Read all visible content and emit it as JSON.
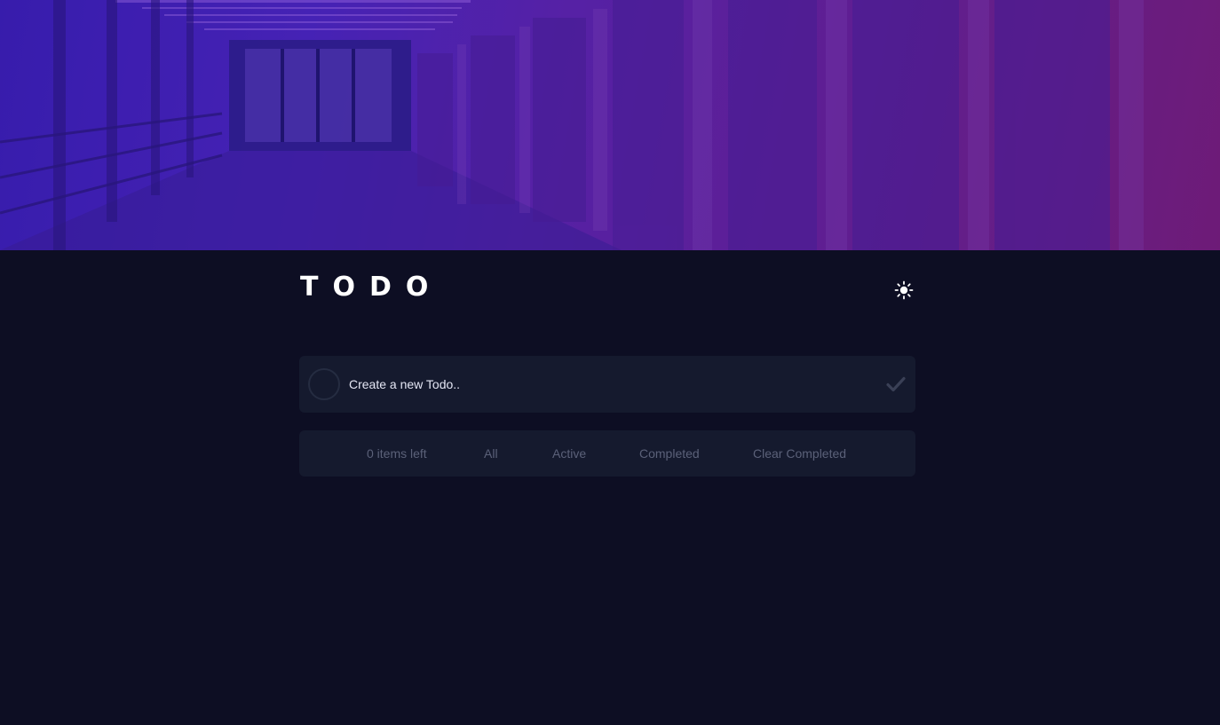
{
  "header": {
    "title": "TODO"
  },
  "theme_toggle": {
    "icon": "sun-icon"
  },
  "new_todo": {
    "placeholder": "Create a new Todo..",
    "value": "",
    "submit_icon": "checkmark-icon"
  },
  "footer": {
    "items_left": "0 items left",
    "filters": {
      "all": "All",
      "active": "Active",
      "completed": "Completed"
    },
    "clear_completed": "Clear Completed"
  },
  "colors": {
    "background": "#0d0e23",
    "card": "#151a2e",
    "muted_text": "#5b6179",
    "hero_gradient_start": "#3a1fb8",
    "hero_gradient_end": "#7a1e7a"
  }
}
